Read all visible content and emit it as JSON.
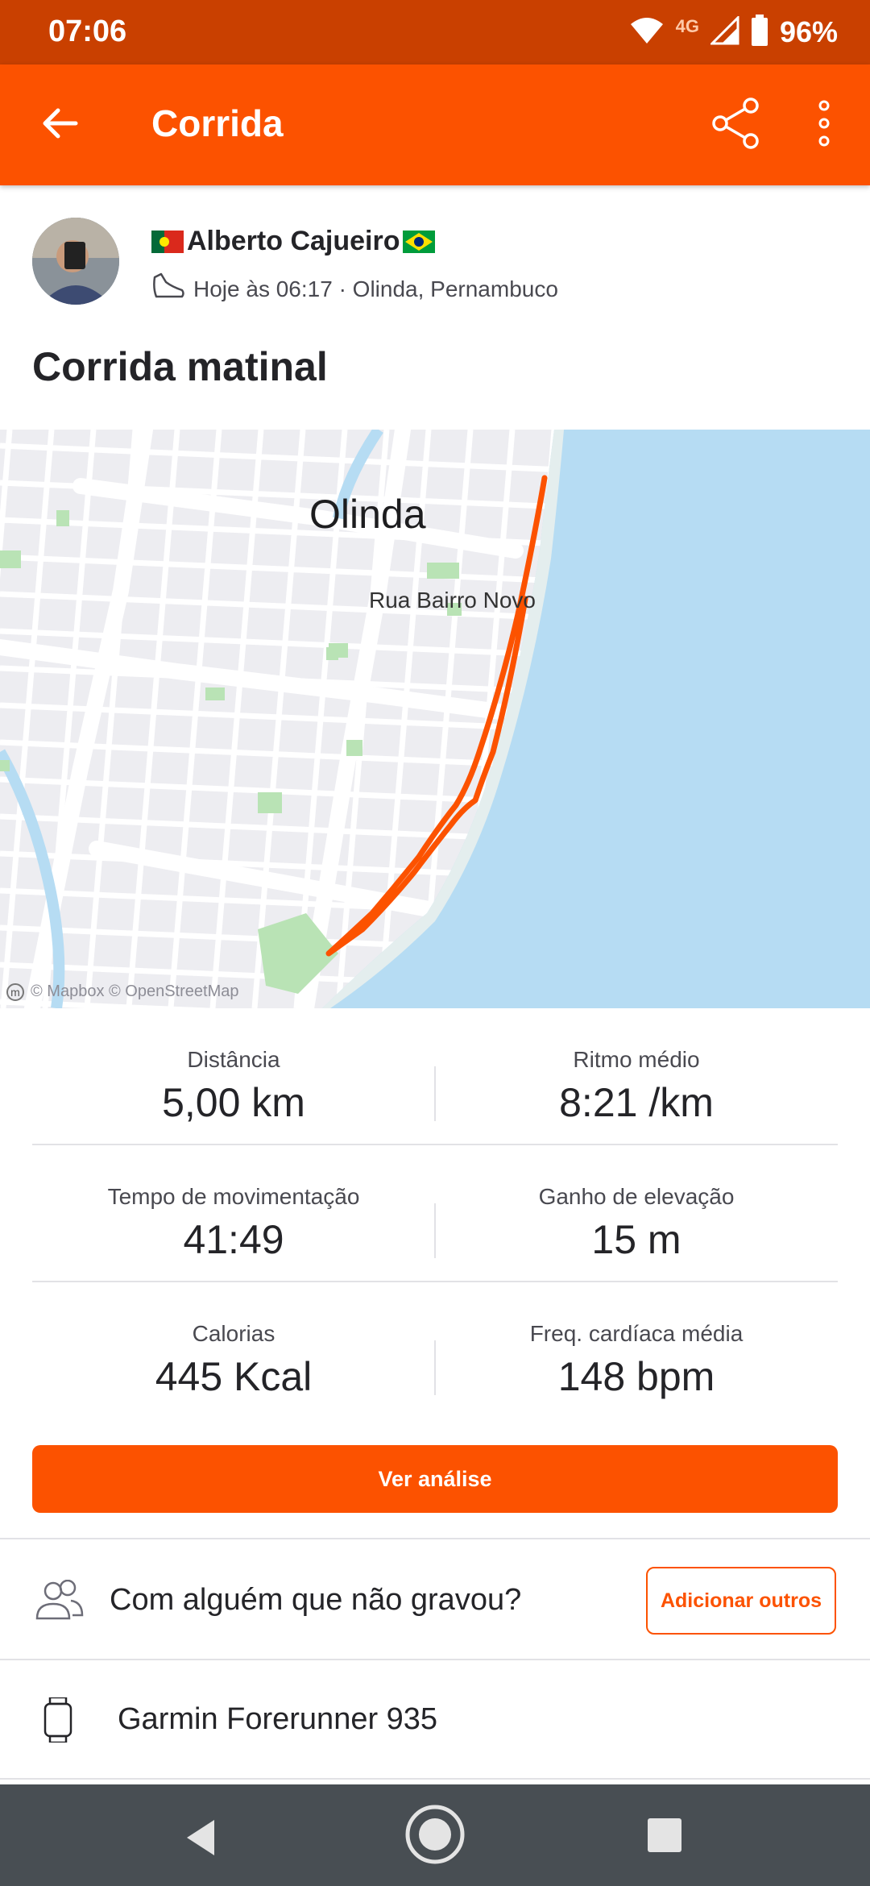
{
  "status_bar": {
    "time": "07:06",
    "network": "4G",
    "battery": "96%"
  },
  "app_bar": {
    "title": "Corrida",
    "icons": [
      "arrow-left-icon",
      "share-icon",
      "more-vertical-icon"
    ]
  },
  "athlete": {
    "name": "Alberto Cajueiro",
    "flags": [
      "portugal-flag-icon",
      "brazil-flag-icon"
    ],
    "activity_time": "Hoje às 06:17 · Olinda, Pernambuco",
    "sport_icon": "shoe-icon"
  },
  "activity": {
    "title": "Corrida matinal"
  },
  "map": {
    "city_label": "Olinda",
    "street_label": "Rua Bairro Novo",
    "attribution": "© Mapbox © OpenStreetMap",
    "colors": {
      "route": "#fc5200",
      "water": "#b6dcf3",
      "land": "#ededf1",
      "park": "#b9e3b5"
    }
  },
  "stats": [
    {
      "label": "Distância",
      "value": "5,00 km"
    },
    {
      "label": "Ritmo médio",
      "value": "8:21 /km"
    },
    {
      "label": "Tempo de movimentação",
      "value": "41:49"
    },
    {
      "label": "Ganho de elevação",
      "value": "15 m"
    },
    {
      "label": "Calorias",
      "value": "445 Kcal"
    },
    {
      "label": "Freq. cardíaca média",
      "value": "148 bpm"
    }
  ],
  "analysis_button": "Ver análise",
  "with_others": {
    "text": "Com alguém que não gravou?",
    "button": "Adicionar outros",
    "icon": "people-icon"
  },
  "device": {
    "name": "Garmin Forerunner 935",
    "icon": "watch-icon"
  },
  "nav_bar": {
    "icons": [
      "nav-back-icon",
      "nav-home-icon",
      "nav-recents-icon"
    ]
  },
  "theme": {
    "accent": "#fc5200",
    "status_bar": "#c94000"
  }
}
